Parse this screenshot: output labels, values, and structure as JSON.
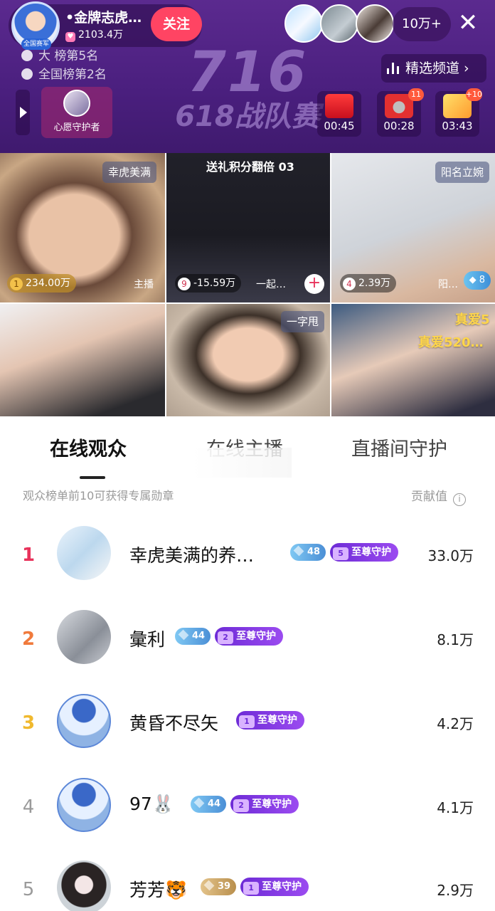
{
  "host": {
    "name": "•金牌志虎…",
    "avatar_tag": "全国赛军",
    "likes": "2103.4万",
    "follow_label": "关注"
  },
  "header": {
    "viewer_count": "10万+",
    "close_icon": "✕",
    "rank_line1": "大 榜第5名",
    "rank_line2": "全国榜第2名",
    "channel_label": "精选频道 ›",
    "watermark_number": "716",
    "watermark_title": "618战队赛"
  },
  "wish": {
    "label": "心愿守护者"
  },
  "timers": [
    {
      "time": "00:45",
      "badge": "",
      "icon": "redpacket-icon"
    },
    {
      "time": "00:28",
      "badge": "11",
      "icon": "bag-icon"
    },
    {
      "time": "03:43",
      "badge": "+10",
      "icon": "gift-box-icon"
    }
  ],
  "streams": {
    "c1": {
      "tag": "幸虎美满",
      "score": "234.00万",
      "rank": "1",
      "caption": "主播"
    },
    "c2": {
      "banner": "送礼积分翻倍 03",
      "score": "-15.59万",
      "rank": "9",
      "caption": "一起…"
    },
    "c3": {
      "tag": "阳名立婉",
      "score": "2.39万",
      "rank": "4",
      "caption": "阳…",
      "diamond": "8"
    },
    "c4": {},
    "c5": {
      "tag": "一字甩"
    },
    "c6": {
      "love1": "真爱5",
      "love2": "真爱520…"
    }
  },
  "sheet": {
    "tabs": [
      "在线观众",
      "在线主播",
      "直播间守护"
    ],
    "subhead": "观众榜单前10可获得专属勋章",
    "contrib_label": "贡献值",
    "info_icon": "i"
  },
  "leaderboard": [
    {
      "rank": "1",
      "name": "幸虎美满的养…",
      "gem": "48",
      "gem_type": "blue",
      "guard_level": "5",
      "guard": "至尊守护",
      "value": "33.0万"
    },
    {
      "rank": "2",
      "name": "彙利",
      "gem": "44",
      "gem_type": "blue",
      "guard_level": "2",
      "guard": "至尊守护",
      "value": "8.1万"
    },
    {
      "rank": "3",
      "name": "黄昏不尽矢",
      "gem": "",
      "gem_type": "",
      "guard_level": "1",
      "guard": "至尊守护",
      "value": "4.2万"
    },
    {
      "rank": "4",
      "name": "97🐰",
      "gem": "44",
      "gem_type": "blue",
      "guard_level": "2",
      "guard": "至尊守护",
      "value": "4.1万"
    },
    {
      "rank": "5",
      "name": "芳芳🐯",
      "gem": "39",
      "gem_type": "gold",
      "guard_level": "1",
      "guard": "至尊守护",
      "value": "2.9万"
    }
  ]
}
